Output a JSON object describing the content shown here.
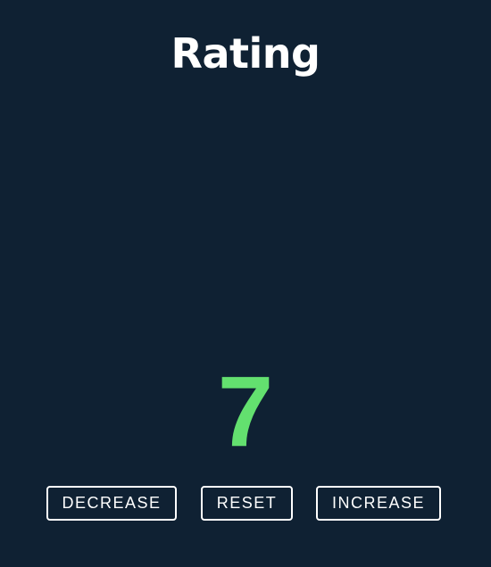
{
  "header": {
    "title": "Rating"
  },
  "rating": {
    "value": "7",
    "value_color": "#63e06f"
  },
  "controls": {
    "decrease_label": "DECREASE",
    "reset_label": "RESET",
    "increase_label": "INCREASE"
  },
  "theme": {
    "background": "#0f2133",
    "foreground": "#ffffff"
  }
}
